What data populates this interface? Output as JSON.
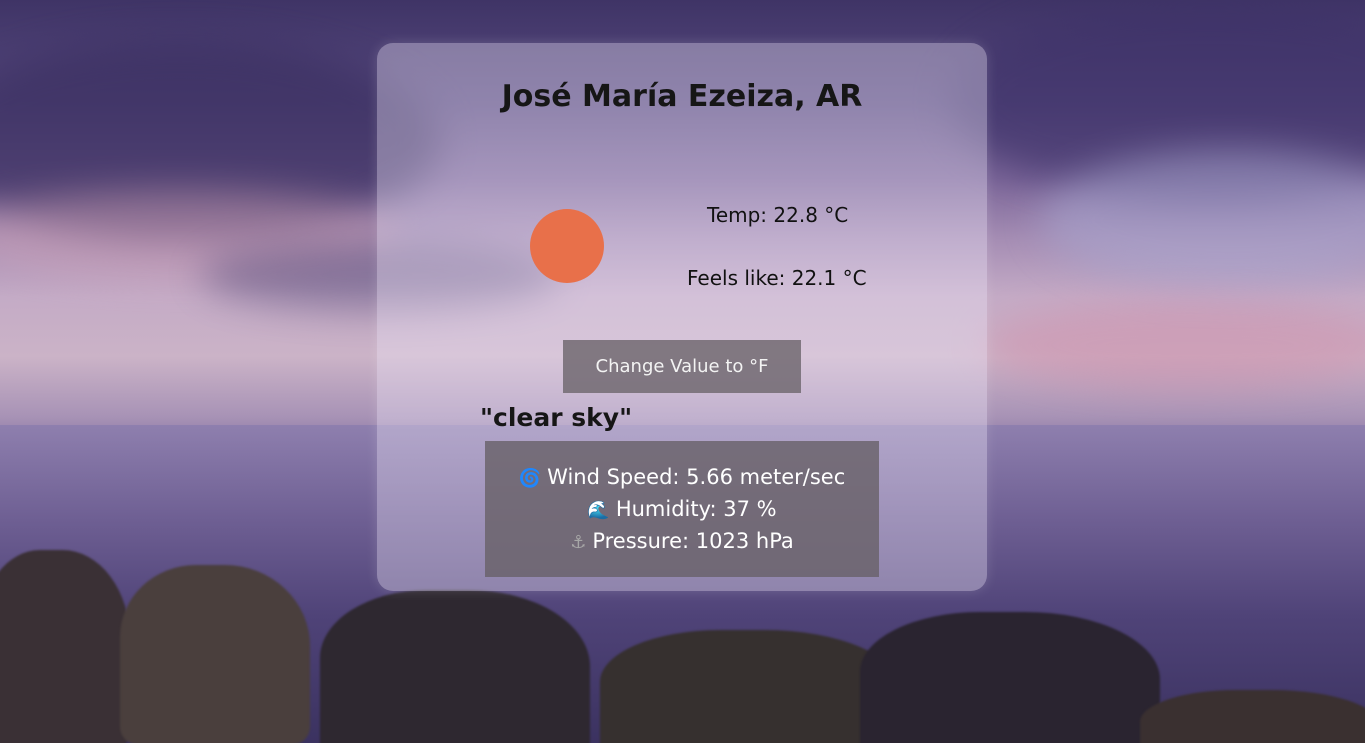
{
  "location": {
    "title": "José María Ezeiza, AR"
  },
  "weather": {
    "icon": "sun-icon",
    "sun_color": "#e8704a",
    "temp_text": "Temp: 22.8 °C",
    "feels_like_text": "Feels like: 22.1 °C",
    "description": "\"clear sky\""
  },
  "controls": {
    "change_unit_label": "Change Value to °F"
  },
  "details": {
    "wind": {
      "icon": "wind-icon",
      "glyph": "🌀",
      "text": "Wind Speed: 5.66 meter/sec"
    },
    "humidity": {
      "icon": "water-wave-icon",
      "glyph": "🌊",
      "text": "Humidity: 37 %"
    },
    "pressure": {
      "icon": "anchor-icon",
      "glyph": "⚓",
      "text": "Pressure: 1023 hPa"
    }
  }
}
